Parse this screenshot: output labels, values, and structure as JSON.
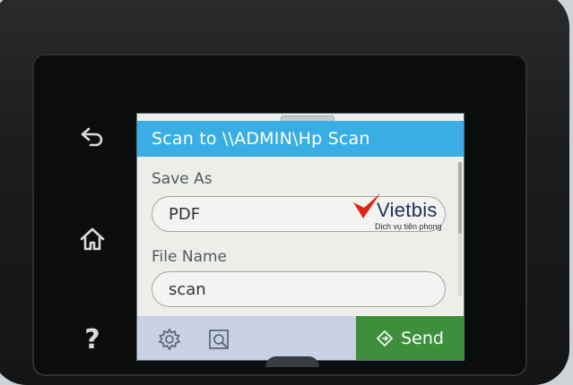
{
  "header": {
    "title": "Scan to \\\\ADMIN\\Hp Scan"
  },
  "fields": [
    {
      "label": "Save As",
      "value": "PDF"
    },
    {
      "label": "File Name",
      "value": "scan"
    }
  ],
  "footer": {
    "send_label": "Send"
  },
  "side_buttons": {
    "back_icon": "back-arrow-icon",
    "home_icon": "home-icon",
    "help_label": "?"
  },
  "watermark": {
    "brand": "Vietbis",
    "tagline": "Dịch vụ tiên phong"
  },
  "colors": {
    "header": "#38aee4",
    "send": "#3e8f3c",
    "footer": "#c9d2e4",
    "screen": "#edeee9"
  }
}
